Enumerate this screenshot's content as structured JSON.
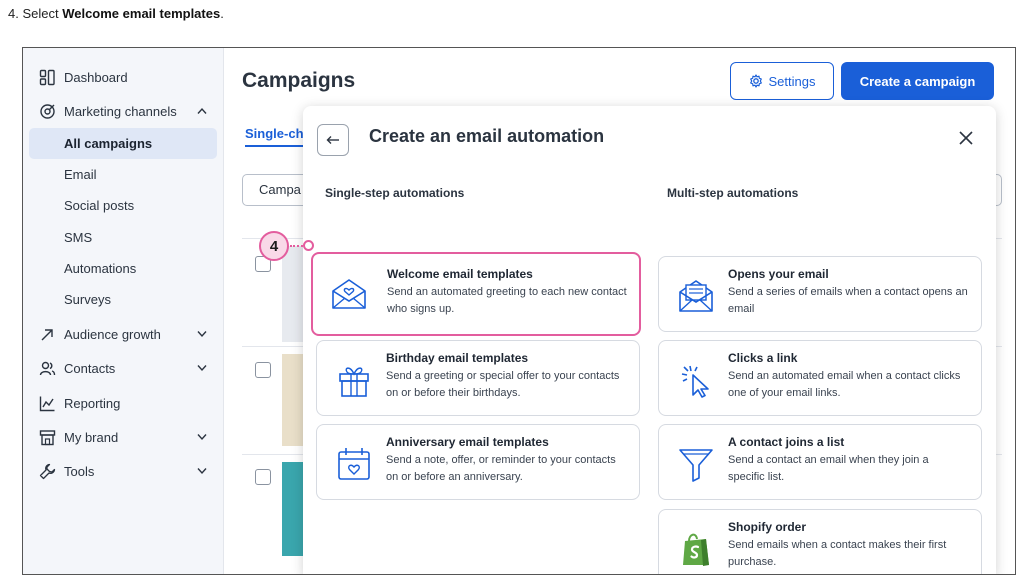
{
  "instruction": {
    "prefix": "4. Select ",
    "bold": "Welcome email templates",
    "suffix": "."
  },
  "sidebar": {
    "items": [
      {
        "label": "Dashboard",
        "icon": "dashboard-icon"
      },
      {
        "label": "Marketing channels",
        "icon": "megaphone-icon",
        "expanded": true
      },
      {
        "label": "All campaigns",
        "active": true
      },
      {
        "label": "Email"
      },
      {
        "label": "Social posts"
      },
      {
        "label": "SMS"
      },
      {
        "label": "Automations"
      },
      {
        "label": "Surveys"
      },
      {
        "label": "Audience growth",
        "icon": "growth-arrow-icon"
      },
      {
        "label": "Contacts",
        "icon": "contacts-icon"
      },
      {
        "label": "Reporting",
        "icon": "chart-icon"
      },
      {
        "label": "My brand",
        "icon": "building-icon"
      },
      {
        "label": "Tools",
        "icon": "wrench-icon"
      }
    ]
  },
  "main": {
    "title": "Campaigns",
    "settings_label": "Settings",
    "create_label": "Create a campaign",
    "tab_label": "Single-ch",
    "search_text": "Campa"
  },
  "modal": {
    "title": "Create an email automation",
    "single_heading": "Single-step automations",
    "multi_heading": "Multi-step automations",
    "single": [
      {
        "title": "Welcome email templates",
        "desc": "Send an automated greeting to each new contact who signs up.",
        "icon": "envelope-heart-icon"
      },
      {
        "title": "Birthday email templates",
        "desc": "Send a greeting or special offer to your contacts on or before their birthdays.",
        "icon": "gift-icon"
      },
      {
        "title": "Anniversary email templates",
        "desc": "Send a note, offer, or reminder to your contacts on or before an anniversary.",
        "icon": "calendar-heart-icon"
      }
    ],
    "multi": [
      {
        "title": "Opens your email",
        "desc": "Send a series of emails when a contact opens an email",
        "icon": "open-envelope-icon"
      },
      {
        "title": "Clicks a link",
        "desc": "Send an automated email when a contact clicks one of your email links.",
        "icon": "cursor-click-icon"
      },
      {
        "title": "A contact joins a list",
        "desc": "Send a contact an email when they join a specific list.",
        "icon": "funnel-icon"
      },
      {
        "title": "Shopify order",
        "desc": "Send emails when a contact makes their first purchase.",
        "icon": "shopify-bag-icon"
      }
    ]
  },
  "callout": {
    "step": "4"
  },
  "colors": {
    "accent": "#1a5fd8",
    "highlight": "#e35d9e",
    "sidebar_bg": "#f4f6fa",
    "active_bg": "#dfe7f6"
  }
}
